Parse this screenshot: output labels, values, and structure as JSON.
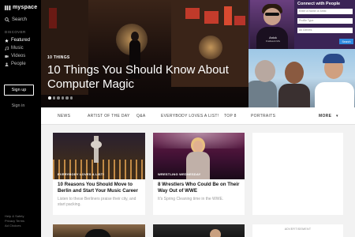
{
  "sidebar": {
    "logo": "myspace",
    "search_label": "Search",
    "section_label": "DISCOVER",
    "nav": [
      {
        "label": "Featured",
        "icon": "star-icon",
        "active": true
      },
      {
        "label": "Music",
        "icon": "music-icon",
        "active": false
      },
      {
        "label": "Videos",
        "icon": "video-icon",
        "active": false
      },
      {
        "label": "People",
        "icon": "people-icon",
        "active": false
      }
    ],
    "signup_label": "Sign up",
    "signin_label": "Sign in",
    "footer": [
      "Help & Safety",
      "Privacy Terms",
      "Ad Choices"
    ]
  },
  "hero": {
    "tag": "10 THINGS",
    "title": "10 Things You Should Know About Computer Magic",
    "dots_total": 6,
    "dots_active": 0
  },
  "promo": {
    "title": "Connect with People",
    "name": "Anick",
    "name_sub": "Kraftwerk Mix",
    "field1": "Enter a Name or Artist",
    "field2": "Profile Type",
    "field3": "All Genres",
    "go": "Search"
  },
  "tabs": [
    "NEWS",
    "ARTIST OF THE DAY",
    "Q&A",
    "EVERYBODY LOVES A LIST!",
    "TOP 8",
    "PORTRAITS"
  ],
  "tabs_more": "MORE",
  "cards": [
    {
      "tag": "EVERYBODY LOVES A LIST!",
      "title": "10 Reasons You Should Move to Berlin and Start Your Music Career",
      "sub": "Listen to these Berliners praise their city, and start packing."
    },
    {
      "tag": "WRESTLING WEDNESDAY",
      "title": "8 Wrestlers Who Could Be on Their Way Out of WWE",
      "sub": "It's Spring Cleaning time in the WWE."
    }
  ],
  "ad_label": "ADVERTISEMENT",
  "colors": {
    "sidebar_bg": "#000000",
    "accent": "#2e8ae0",
    "promo_bg": "#3b2456"
  }
}
